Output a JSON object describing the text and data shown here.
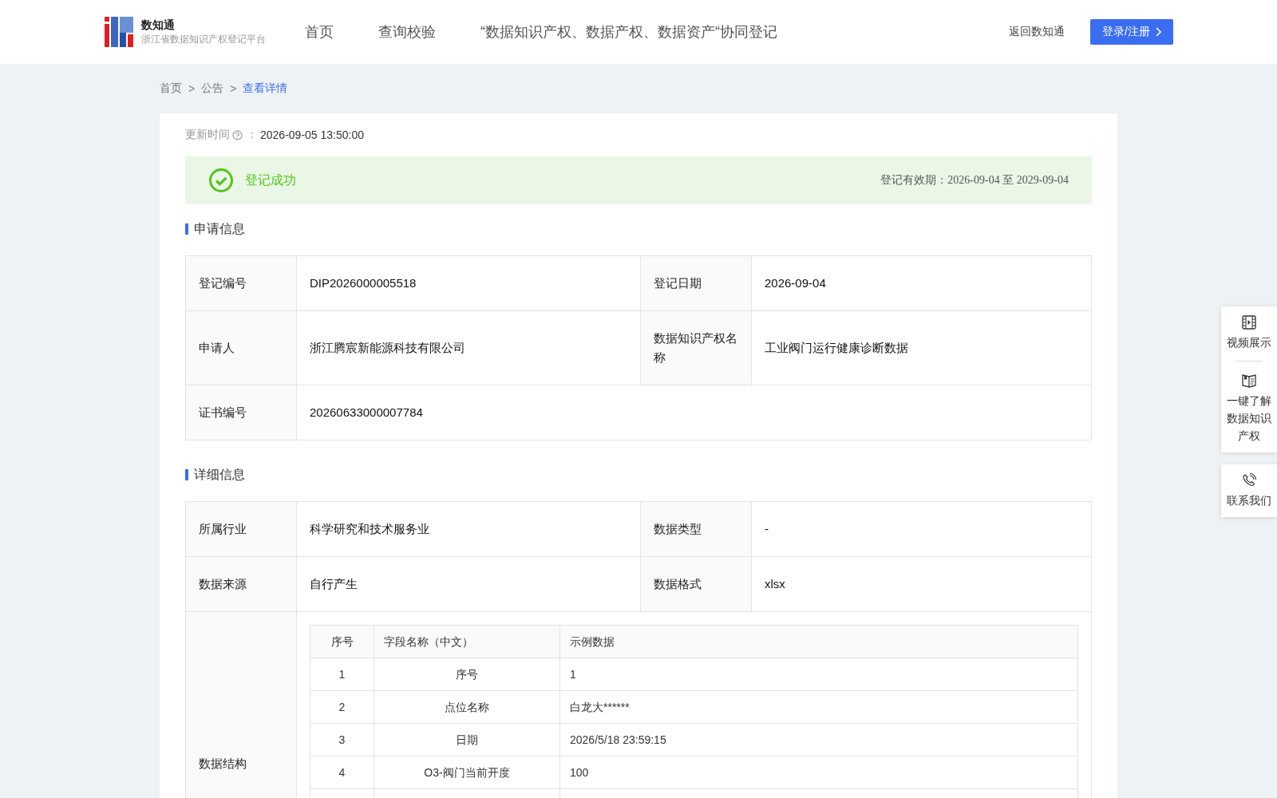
{
  "header": {
    "logo": {
      "title": "数知通",
      "subtitle": "浙江省数据知识产权登记平台"
    },
    "nav": [
      "首页",
      "查询校验",
      "“数据知识产权、数据产权、数据资产“协同登记"
    ],
    "back_link": "返回数知通",
    "login_button": "登录/注册"
  },
  "breadcrumb": [
    {
      "label": "首页",
      "current": false
    },
    {
      "label": "公告",
      "current": false
    },
    {
      "label": "查看详情",
      "current": true
    }
  ],
  "breadcrumb_separator": ">",
  "update": {
    "label": "更新时间",
    "separator": "：",
    "value": "2026-09-05 13:50:00"
  },
  "status": {
    "kind": "success",
    "text": "登记成功",
    "validity": "登记有效期：2026-09-04 至 2029-09-04"
  },
  "sections": [
    {
      "title": "申请信息",
      "rows": [
        [
          {
            "label": "登记编号",
            "value": "DIP2026000005518"
          },
          {
            "label": "登记日期",
            "value": "2026-09-04"
          }
        ],
        [
          {
            "label": "申请人",
            "value": "浙江腾宸新能源科技有限公司"
          },
          {
            "label": "数据知识产权名称",
            "value": "工业阀门运行健康诊断数据"
          }
        ],
        [
          {
            "label": "证书编号",
            "value": "20260633000007784"
          }
        ]
      ]
    },
    {
      "title": "详细信息",
      "rows": [
        [
          {
            "label": "所属行业",
            "value": "科学研究和技术服务业"
          },
          {
            "label": "数据类型",
            "value": "-"
          }
        ],
        [
          {
            "label": "数据来源",
            "value": "自行产生"
          },
          {
            "label": "数据格式",
            "value": "xlsx"
          }
        ],
        [
          {
            "label": "数据结构",
            "kind": "table",
            "table": {
              "columns": [
                "序号",
                "字段名称（中文）",
                "示例数据"
              ],
              "rows": [
                [
                  "1",
                  "序号",
                  "1"
                ],
                [
                  "2",
                  "点位名称",
                  "白龙大******"
                ],
                [
                  "3",
                  "日期",
                  "2026/5/18 23:59:15"
                ],
                [
                  "4",
                  "O3-阀门当前开度",
                  "100"
                ]
              ]
            }
          }
        ]
      ]
    }
  ],
  "side_cards": [
    {
      "items": [
        {
          "kind": "video",
          "label": "视频展示"
        },
        {
          "kind": "book",
          "label": "一键了解数据知识产权"
        }
      ]
    },
    {
      "items": [
        {
          "kind": "phone",
          "label": "联系我们"
        }
      ]
    }
  ]
}
